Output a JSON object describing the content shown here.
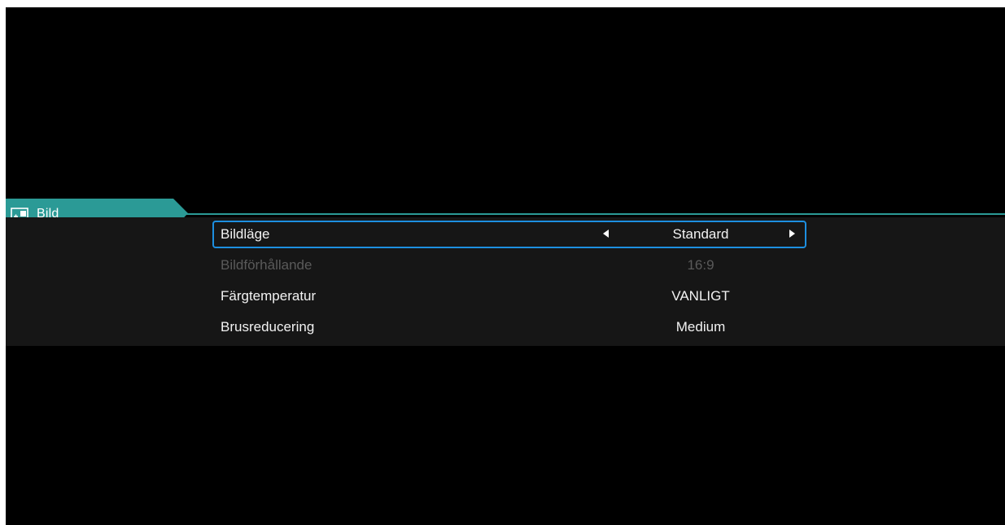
{
  "menu": {
    "tab": {
      "label": "Bild",
      "icon": "picture-settings-icon",
      "color": "#2b9a96"
    },
    "items": [
      {
        "label": "Bildläge",
        "value": "Standard",
        "selected": true,
        "enabled": true
      },
      {
        "label": "Bildförhållande",
        "value": "16:9",
        "selected": false,
        "enabled": false
      },
      {
        "label": "Färgtemperatur",
        "value": "VANLIGT",
        "selected": false,
        "enabled": true
      },
      {
        "label": "Brusreducering",
        "value": "Medium",
        "selected": false,
        "enabled": true
      }
    ],
    "selection_color": "#1d8fe0",
    "prev_icon": "arrow-left-icon",
    "next_icon": "arrow-right-icon"
  }
}
